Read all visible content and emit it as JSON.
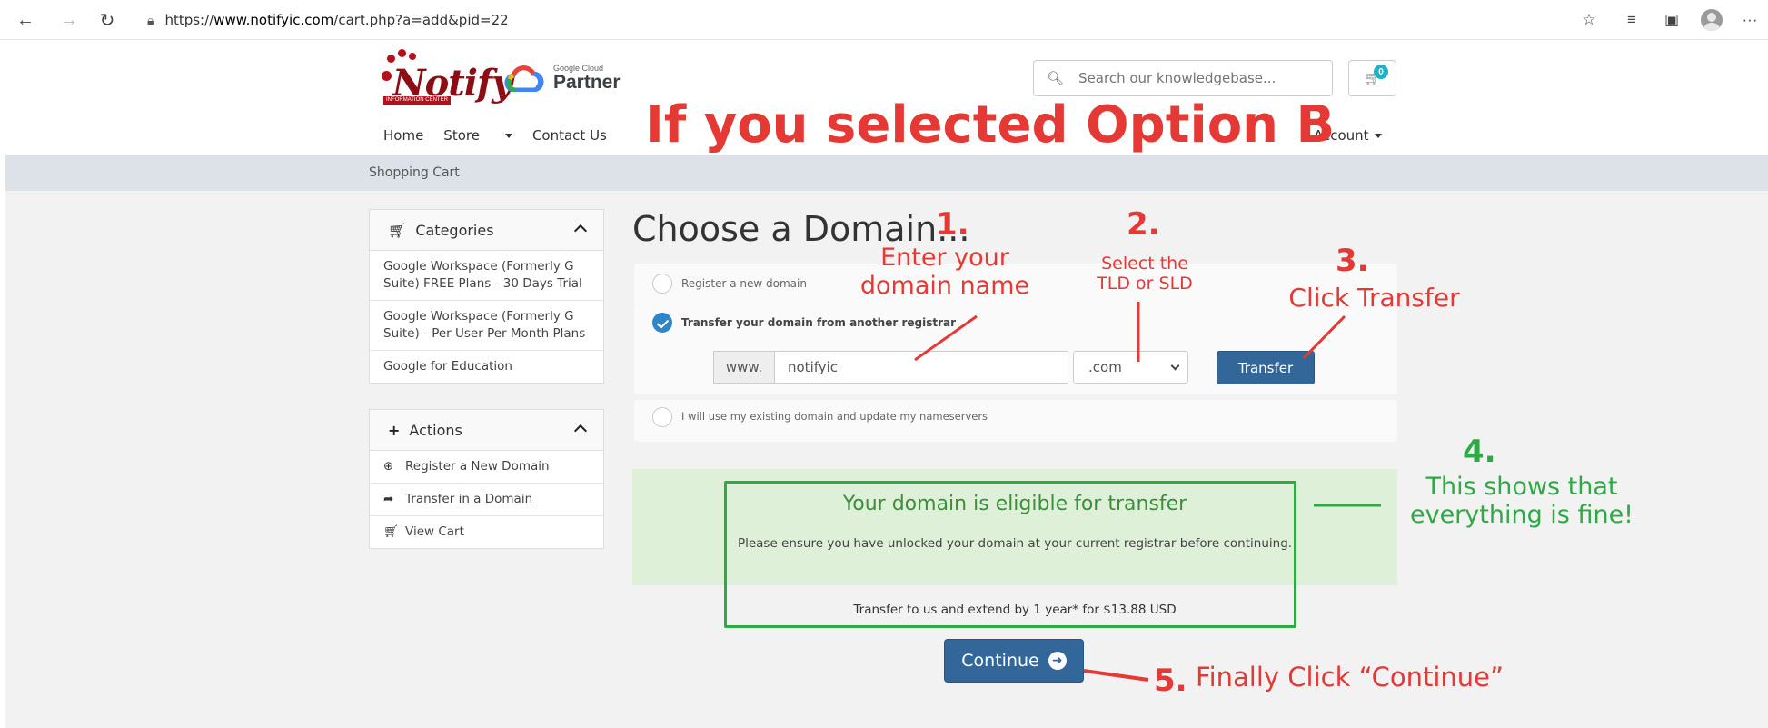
{
  "browser": {
    "url_prefix": "https://",
    "url_host": "www.notifyic.com",
    "url_path": "/cart.php?a=add&pid=22"
  },
  "header": {
    "logo_script": "Notify",
    "logo_banner": "INFORMATION CENTER",
    "partner_small": "Google Cloud",
    "partner_big": "Partner",
    "search_placeholder": "Search our knowledgebase...",
    "cart_count": "0",
    "nav": [
      "Home",
      "Store",
      "Contact Us"
    ],
    "account": "Account"
  },
  "breadcrumb": "Shopping Cart",
  "sidebar": {
    "categories_title": "Categories",
    "categories": [
      "Google Workspace (Formerly G Suite) FREE Plans - 30 Days Trial",
      "Google Workspace (Formerly G Suite) - Per User Per Month Plans",
      "Google for Education"
    ],
    "actions_title": "Actions",
    "actions": [
      "Register a New Domain",
      "Transfer in a Domain",
      "View Cart"
    ]
  },
  "domain": {
    "title": "Choose a Domain...",
    "opt_register": "Register a new domain",
    "opt_transfer": "Transfer your domain from another registrar",
    "opt_existing": "I will use my existing domain and update my nameservers",
    "www": "www.",
    "domain_value": "notifyic",
    "tld_value": ".com",
    "transfer_label": "Transfer",
    "eligible_title": "Your domain is eligible for transfer",
    "eligible_text": "Please ensure you have unlocked your domain at your current registrar before continuing.",
    "price_text": "Transfer to us and extend by 1 year* for $13.88 USD",
    "continue_label": "Continue"
  },
  "annotations": {
    "heading": "If you selected Option B",
    "step1_num": "1.",
    "step1_text": "Enter your domain name",
    "step2_num": "2.",
    "step2_text": "Select the TLD or SLD",
    "step3_num": "3.",
    "step3_text": "Click Transfer",
    "step4_num": "4.",
    "step4_text": "This shows that everything is fine!",
    "step5_num": "5.",
    "step5_text": "Finally Click “Continue”"
  },
  "colors": {
    "annotation_red": "#e53935",
    "annotation_green": "#2eaa45",
    "button_blue": "#336699",
    "success_bg": "#dff0d8"
  }
}
